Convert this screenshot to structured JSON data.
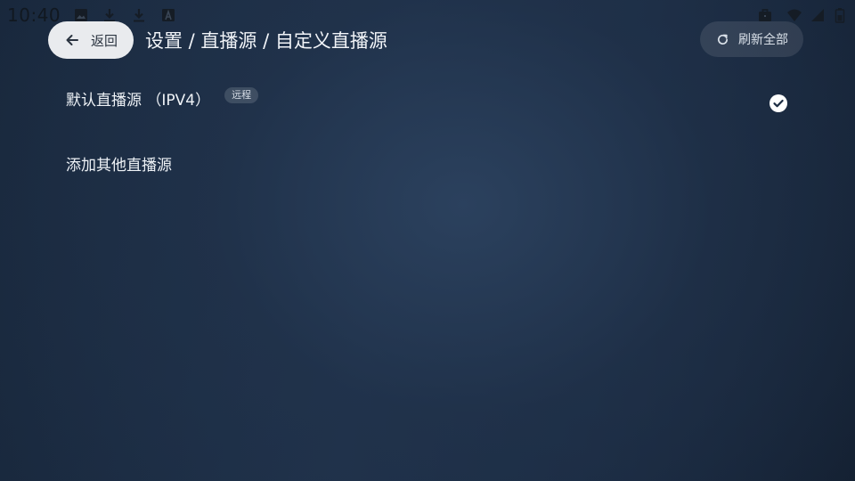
{
  "status_bar": {
    "time": "10:40",
    "icons": [
      "image-icon",
      "download-icon",
      "download-icon",
      "a-letter-icon",
      "briefcase-icon",
      "wifi-icon",
      "signal-icon",
      "battery-icon"
    ]
  },
  "header": {
    "back_label": "返回",
    "breadcrumb": "设置 / 直播源 / 自定义直播源",
    "refresh_label": "刷新全部"
  },
  "sources": [
    {
      "label": "默认直播源 （IPV4）",
      "tag": "远程",
      "selected": true
    },
    {
      "label": "添加其他直播源"
    }
  ],
  "colors": {
    "background": "#1b2b40",
    "back_button_bg": "#e9ebee",
    "text": "#eef2f6",
    "check": "#ffffff"
  }
}
